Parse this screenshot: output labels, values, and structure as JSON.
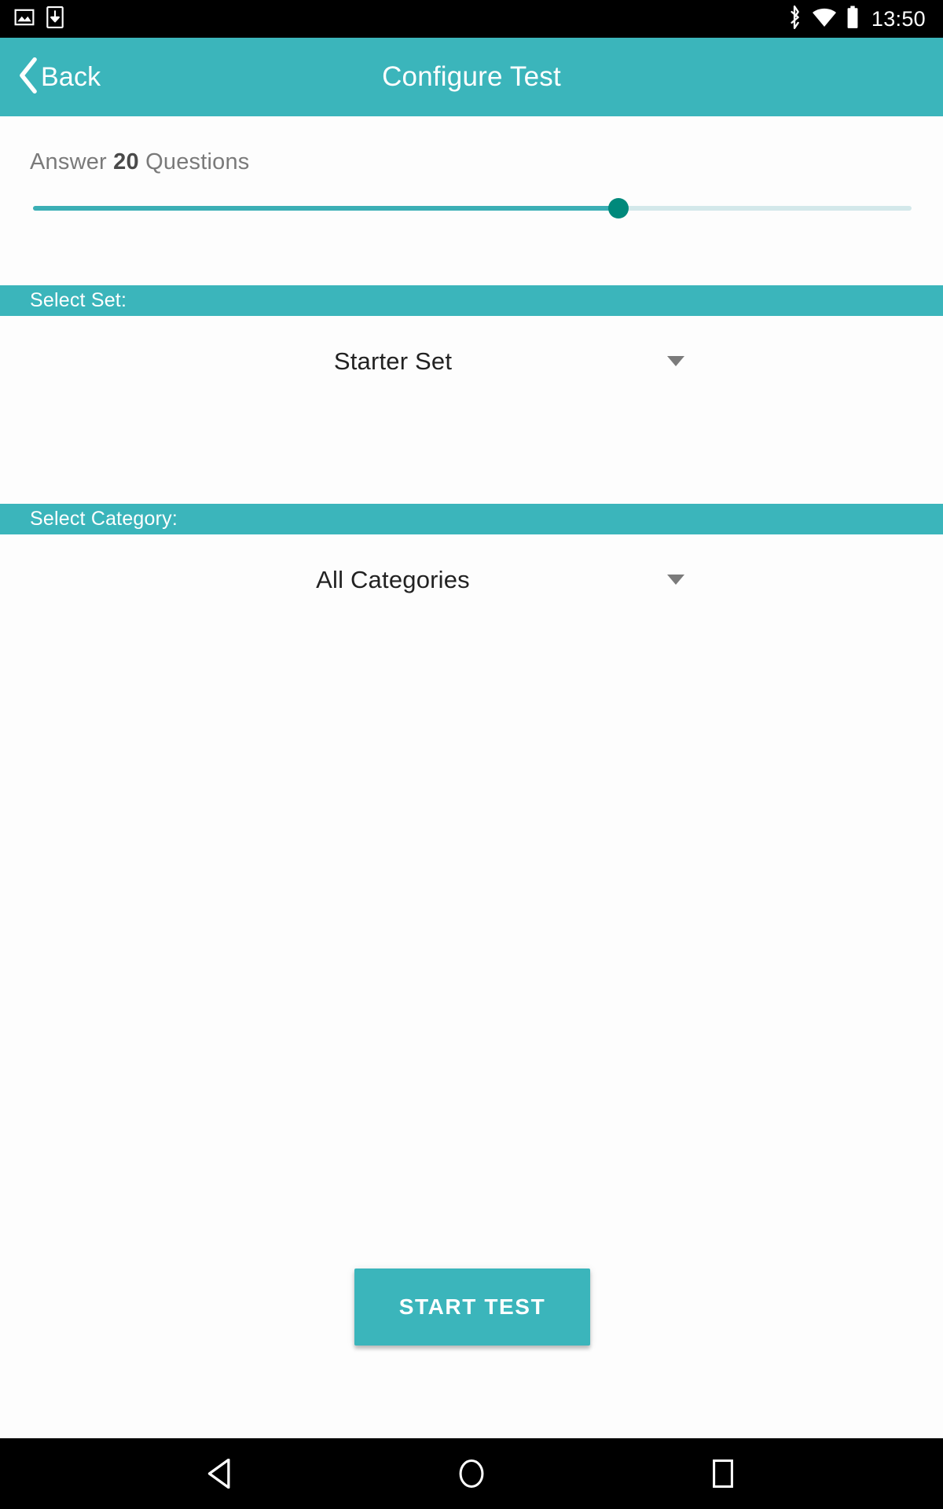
{
  "status_bar": {
    "icons_left": [
      "image-icon",
      "download-icon"
    ],
    "icons_right": [
      "bluetooth-icon",
      "wifi-icon",
      "battery-icon"
    ],
    "time": "13:50"
  },
  "app_bar": {
    "back_label": "Back",
    "back_icon": "chevron-left-icon",
    "title": "Configure Test",
    "background_color": "#3BB5BB"
  },
  "question_count": {
    "prefix": "Answer",
    "value": "20",
    "suffix": "Questions"
  },
  "slider": {
    "value": 20,
    "min": 1,
    "max": 30,
    "fill_color": "#3BAFB5",
    "track_color": "#D3E8EA",
    "thumb_color": "#00897B"
  },
  "set_section": {
    "header": "Select Set:",
    "selected": "Starter Set",
    "caret_icon": "chevron-down-icon"
  },
  "category_section": {
    "header": "Select Category:",
    "selected": "All Categories",
    "caret_icon": "chevron-down-icon"
  },
  "actions": {
    "start_label": "START TEST",
    "start_color": "#3BB5BB"
  },
  "nav_bar": {
    "back_icon": "nav-back-triangle-icon",
    "home_icon": "nav-home-circle-icon",
    "recents_icon": "nav-recents-square-icon"
  }
}
